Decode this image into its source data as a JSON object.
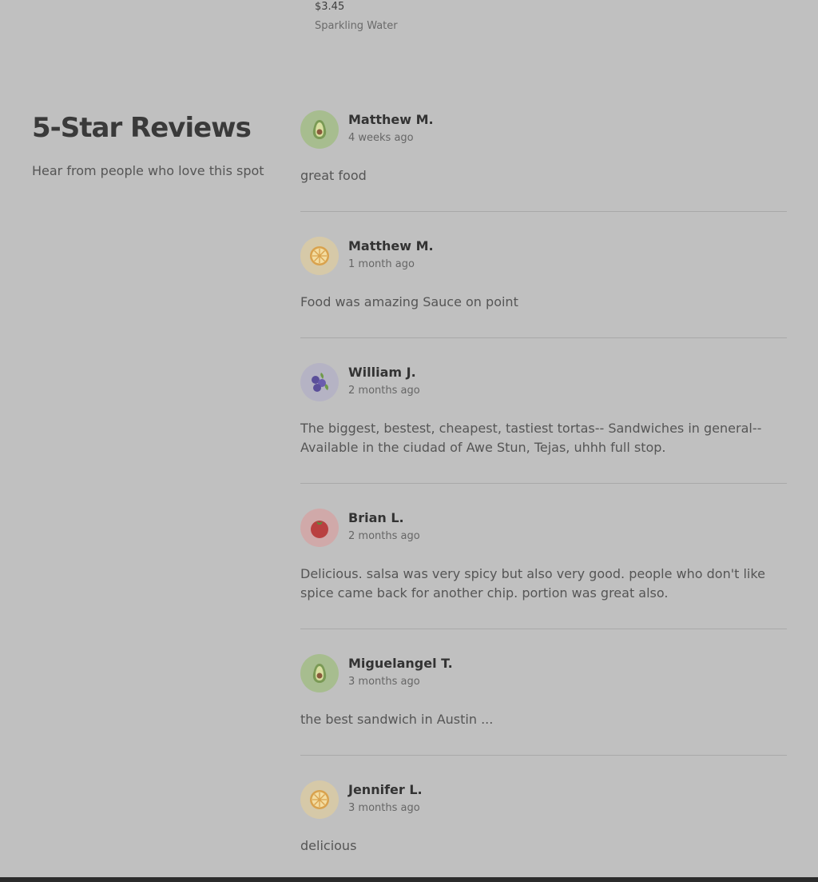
{
  "top_item": {
    "price": "$3.45",
    "name": "Sparkling Water"
  },
  "section": {
    "title": "5-Star Reviews",
    "subtitle": "Hear from people who love this spot"
  },
  "reviews": [
    {
      "name": "Matthew M.",
      "time": "4 weeks ago",
      "text": "great food",
      "avatar_icon": "avocado-icon",
      "avatar_bg": "#a7bd8f"
    },
    {
      "name": "Matthew M.",
      "time": "1 month ago",
      "text": "Food was amazing Sauce on point",
      "avatar_icon": "lemon-icon",
      "avatar_bg": "#d6c9a8"
    },
    {
      "name": "William J.",
      "time": "2 months ago",
      "text": "The biggest, bestest, cheapest, tastiest tortas-- Sandwiches in general-- Available in the ciudad of Awe Stun, Tejas, uhhh full stop.",
      "avatar_icon": "blueberries-icon",
      "avatar_bg": "#b5b3c4"
    },
    {
      "name": "Brian L.",
      "time": "2 months ago",
      "text": "Delicious. salsa was very spicy but also very good. people who don't like spice came back for another chip. portion was great also.",
      "avatar_icon": "tomato-icon",
      "avatar_bg": "#d0a9a9"
    },
    {
      "name": "Miguelangel T.",
      "time": "3 months ago",
      "text": "the best sandwich in Austin ...",
      "avatar_icon": "avocado-icon",
      "avatar_bg": "#a7bd8f"
    },
    {
      "name": "Jennifer L.",
      "time": "3 months ago",
      "text": "delicious",
      "avatar_icon": "lemon-icon",
      "avatar_bg": "#d6c9a8"
    }
  ]
}
